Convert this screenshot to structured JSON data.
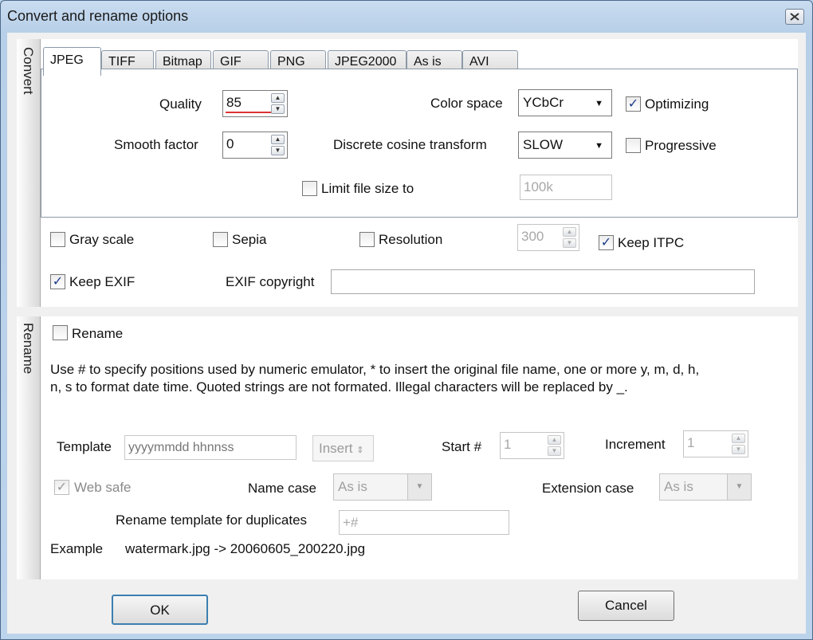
{
  "window": {
    "title": "Convert and rename options"
  },
  "convert": {
    "section_label": "Convert",
    "tabs": [
      "JPEG",
      "TIFF",
      "Bitmap",
      "GIF",
      "PNG",
      "JPEG2000",
      "As is",
      "AVI"
    ],
    "jpeg": {
      "quality_label": "Quality",
      "quality_value": "85",
      "smooth_label": "Smooth factor",
      "smooth_value": "0",
      "color_space_label": "Color space",
      "color_space_value": "YCbCr",
      "dct_label": "Discrete  cosine  transform",
      "dct_value": "SLOW",
      "optimizing_label": "Optimizing",
      "optimizing_checked": true,
      "progressive_label": "Progressive",
      "progressive_checked": false,
      "limit_label": "Limit file size to",
      "limit_checked": false,
      "limit_value": "100k"
    },
    "gray_scale_label": "Gray scale",
    "sepia_label": "Sepia",
    "resolution_label": "Resolution",
    "resolution_value": "300",
    "keep_itpc_label": "Keep ITPC",
    "keep_exif_label": "Keep EXIF",
    "exif_copyright_label": "EXIF copyright",
    "exif_copyright_value": ""
  },
  "rename": {
    "section_label": "Rename",
    "rename_label": "Rename",
    "description": "Use # to specify positions used by numeric emulator, * to insert the original file name, one or more y, m, d, h, n, s to format date time. Quoted strings are not formated. Illegal characters will be replaced by _.",
    "template_label": "Template",
    "template_placeholder": "yyyymmdd hhnnss",
    "insert_label": "Insert",
    "start_label": "Start #",
    "start_value": "1",
    "increment_label": "Increment",
    "increment_value": "1",
    "web_safe_label": "Web safe",
    "name_case_label": "Name case",
    "name_case_value": "As is",
    "extension_case_label": "Extension case",
    "extension_case_value": "As is",
    "duplicates_label": "Rename template for duplicates",
    "duplicates_value": "+#",
    "example_label": "Example",
    "example_value": "watermark.jpg -> 20060605_200220.jpg"
  },
  "buttons": {
    "ok": "OK",
    "cancel": "Cancel"
  }
}
